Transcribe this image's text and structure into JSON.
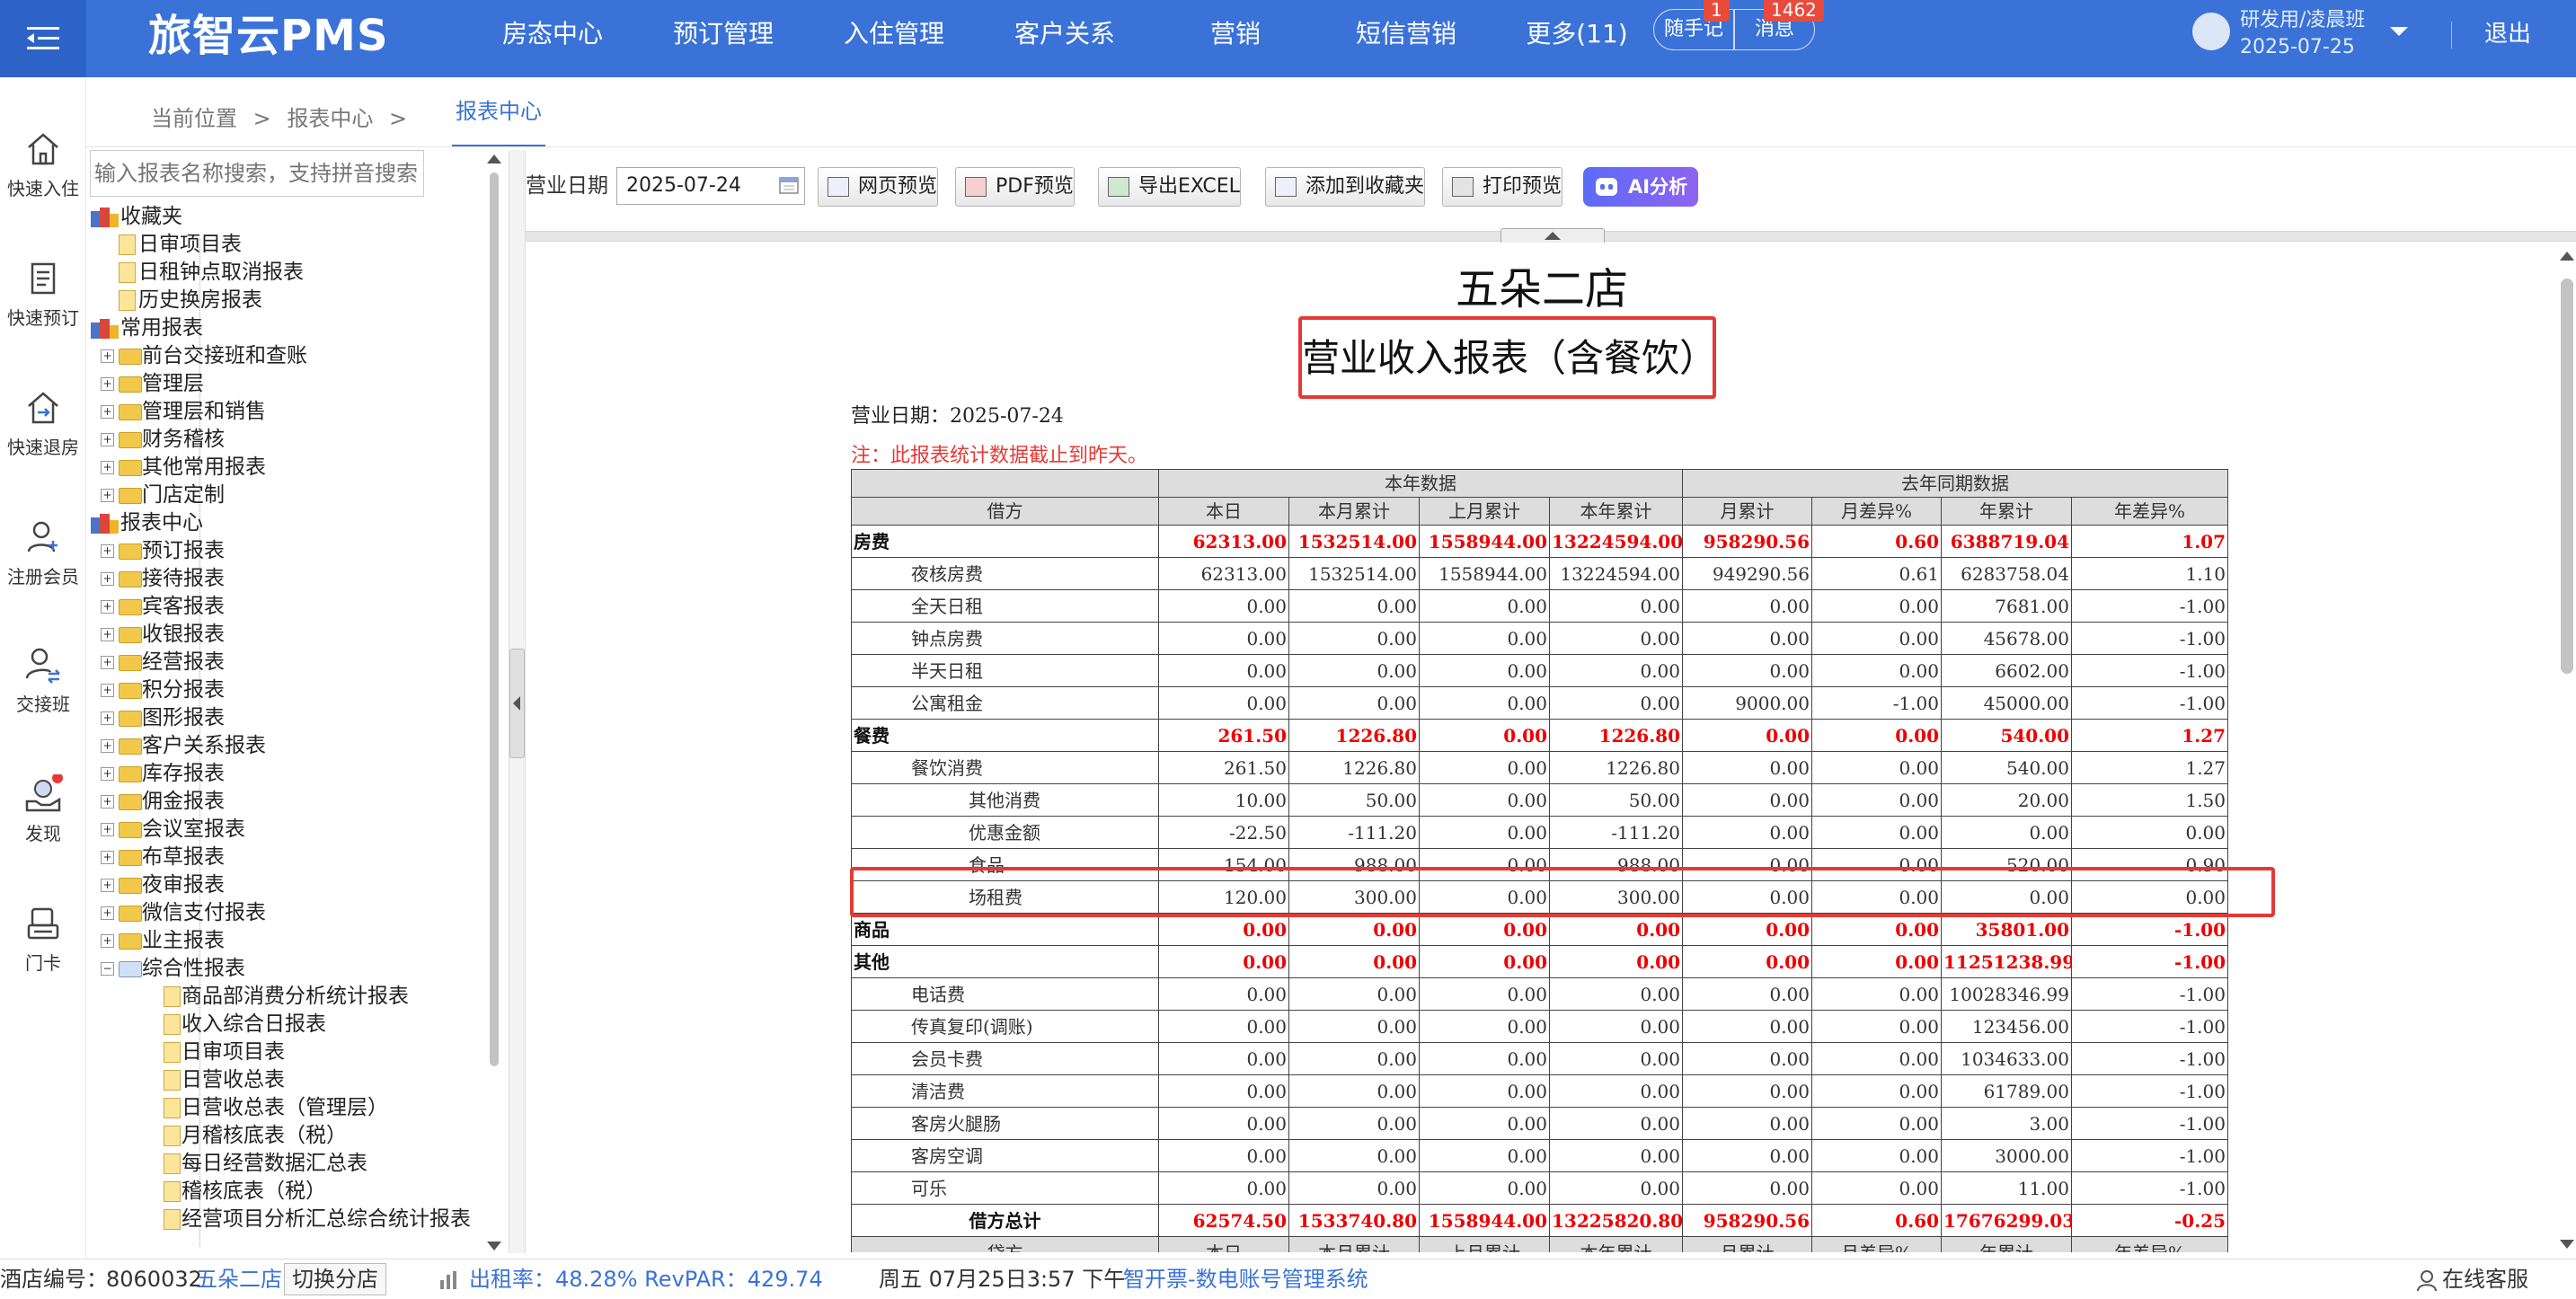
{
  "app": {
    "logo": "旅智云PMS"
  },
  "nav": [
    "房态中心",
    "预订管理",
    "入住管理",
    "客户关系",
    "营销",
    "短信营销",
    "更多(11)"
  ],
  "header": {
    "notes_label": "随手记",
    "notes_badge": "1",
    "msg_label": "消息",
    "msg_badge": "1462",
    "user_name": "研发用/凌晨班",
    "user_date": "2025-07-25",
    "logout": "退出"
  },
  "sidebar": [
    {
      "label": "快速入住",
      "icon": "home-icon"
    },
    {
      "label": "快速预订",
      "icon": "booking-icon"
    },
    {
      "label": "快速退房",
      "icon": "checkout-icon"
    },
    {
      "label": "注册会员",
      "icon": "add-member-icon"
    },
    {
      "label": "交接班",
      "icon": "shift-icon"
    },
    {
      "label": "发现",
      "icon": "discover-icon"
    },
    {
      "label": "门卡",
      "icon": "card-icon"
    }
  ],
  "breadcrumb": {
    "current": "当前位置",
    "sep1": ">",
    "item": "报表中心",
    "sep2": ">"
  },
  "tab": "报表中心",
  "tree": {
    "search_placeholder": "输入报表名称搜索，支持拼音搜索",
    "nodes": [
      {
        "level": 0,
        "type": "cat",
        "label": "收藏夹"
      },
      {
        "level": 1,
        "type": "doc",
        "label": "日审项目表"
      },
      {
        "level": 1,
        "type": "doc",
        "label": "日租钟点取消报表"
      },
      {
        "level": 1,
        "type": "doc",
        "label": "历史换房报表"
      },
      {
        "level": 0,
        "type": "cat",
        "label": "常用报表"
      },
      {
        "level": 1,
        "type": "folder",
        "label": "前台交接班和查账"
      },
      {
        "level": 1,
        "type": "folder",
        "label": "管理层"
      },
      {
        "level": 1,
        "type": "folder",
        "label": "管理层和销售"
      },
      {
        "level": 1,
        "type": "folder",
        "label": "财务稽核"
      },
      {
        "level": 1,
        "type": "folder",
        "label": "其他常用报表"
      },
      {
        "level": 1,
        "type": "folder",
        "label": "门店定制"
      },
      {
        "level": 0,
        "type": "cat",
        "label": "报表中心"
      },
      {
        "level": 1,
        "type": "folder",
        "label": "预订报表"
      },
      {
        "level": 1,
        "type": "folder",
        "label": "接待报表"
      },
      {
        "level": 1,
        "type": "folder",
        "label": "宾客报表"
      },
      {
        "level": 1,
        "type": "folder",
        "label": "收银报表"
      },
      {
        "level": 1,
        "type": "folder",
        "label": "经营报表"
      },
      {
        "level": 1,
        "type": "folder",
        "label": "积分报表"
      },
      {
        "level": 1,
        "type": "folder",
        "label": "图形报表"
      },
      {
        "level": 1,
        "type": "folder",
        "label": "客户关系报表"
      },
      {
        "level": 1,
        "type": "folder",
        "label": "库存报表"
      },
      {
        "level": 1,
        "type": "folder",
        "label": "佣金报表"
      },
      {
        "level": 1,
        "type": "folder",
        "label": "会议室报表"
      },
      {
        "level": 1,
        "type": "folder",
        "label": "布草报表"
      },
      {
        "level": 1,
        "type": "folder",
        "label": "夜审报表"
      },
      {
        "level": 1,
        "type": "folder",
        "label": "微信支付报表"
      },
      {
        "level": 1,
        "type": "folder",
        "label": "业主报表"
      },
      {
        "level": 1,
        "type": "openfolder",
        "label": "综合性报表"
      },
      {
        "level": 2,
        "type": "doc",
        "label": "商品部消费分析统计报表"
      },
      {
        "level": 2,
        "type": "doc",
        "label": "收入综合日报表"
      },
      {
        "level": 2,
        "type": "doc",
        "label": "日审项目表"
      },
      {
        "level": 2,
        "type": "doc",
        "label": "日营收总表"
      },
      {
        "level": 2,
        "type": "doc",
        "label": "日营收总表（管理层）"
      },
      {
        "level": 2,
        "type": "doc",
        "label": "月稽核底表（税）"
      },
      {
        "level": 2,
        "type": "doc",
        "label": "每日经营数据汇总表"
      },
      {
        "level": 2,
        "type": "doc",
        "label": "稽核底表（税）"
      },
      {
        "level": 2,
        "type": "doc",
        "label": "经营项目分析汇总综合统计报表"
      }
    ]
  },
  "toolbar": {
    "date_label": "营业日期",
    "date_value": "2025-07-24",
    "btn_web": "网页预览",
    "btn_pdf": "PDF预览",
    "btn_excel": "导出EXCEL",
    "btn_fav": "添加到收藏夹",
    "btn_print": "打印预览",
    "btn_ai": "AI分析"
  },
  "report": {
    "hotel": "五朵二店",
    "title": "营业收入报表（含餐饮）",
    "date_line": "营业日期：2025-07-24",
    "note": "注：此报表统计数据截止到昨天。",
    "group_this": "本年数据",
    "group_last": "去年同期数据",
    "columns": [
      "借方",
      "本日",
      "本月累计",
      "上月累计",
      "本年累计",
      "月累计",
      "月差异%",
      "年累计",
      "年差异%"
    ],
    "rows": [
      {
        "kind": "cat",
        "label": "房费",
        "values": [
          "62313.00",
          "1532514.00",
          "1558944.00",
          "13224594.00",
          "958290.56",
          "0.60",
          "6388719.04",
          "1.07"
        ]
      },
      {
        "kind": "l1",
        "label": "夜核房费",
        "values": [
          "62313.00",
          "1532514.00",
          "1558944.00",
          "13224594.00",
          "949290.56",
          "0.61",
          "6283758.04",
          "1.10"
        ]
      },
      {
        "kind": "l1",
        "label": "全天日租",
        "values": [
          "0.00",
          "0.00",
          "0.00",
          "0.00",
          "0.00",
          "0.00",
          "7681.00",
          "-1.00"
        ]
      },
      {
        "kind": "l1",
        "label": "钟点房费",
        "values": [
          "0.00",
          "0.00",
          "0.00",
          "0.00",
          "0.00",
          "0.00",
          "45678.00",
          "-1.00"
        ]
      },
      {
        "kind": "l1",
        "label": "半天日租",
        "values": [
          "0.00",
          "0.00",
          "0.00",
          "0.00",
          "0.00",
          "0.00",
          "6602.00",
          "-1.00"
        ]
      },
      {
        "kind": "l1",
        "label": "公寓租金",
        "values": [
          "0.00",
          "0.00",
          "0.00",
          "0.00",
          "9000.00",
          "-1.00",
          "45000.00",
          "-1.00"
        ]
      },
      {
        "kind": "cat",
        "label": "餐费",
        "values": [
          "261.50",
          "1226.80",
          "0.00",
          "1226.80",
          "0.00",
          "0.00",
          "540.00",
          "1.27"
        ]
      },
      {
        "kind": "l1",
        "label": "餐饮消费",
        "values": [
          "261.50",
          "1226.80",
          "0.00",
          "1226.80",
          "0.00",
          "0.00",
          "540.00",
          "1.27"
        ]
      },
      {
        "kind": "l2",
        "label": "其他消费",
        "values": [
          "10.00",
          "50.00",
          "0.00",
          "50.00",
          "0.00",
          "0.00",
          "20.00",
          "1.50"
        ]
      },
      {
        "kind": "l2",
        "label": "优惠金额",
        "values": [
          "-22.50",
          "-111.20",
          "0.00",
          "-111.20",
          "0.00",
          "0.00",
          "0.00",
          "0.00"
        ]
      },
      {
        "kind": "l2",
        "label": "食品",
        "values": [
          "154.00",
          "988.00",
          "0.00",
          "988.00",
          "0.00",
          "0.00",
          "520.00",
          "0.90"
        ]
      },
      {
        "kind": "l2",
        "label": "场租费",
        "values": [
          "120.00",
          "300.00",
          "0.00",
          "300.00",
          "0.00",
          "0.00",
          "0.00",
          "0.00"
        ]
      },
      {
        "kind": "cat",
        "label": "商品",
        "values": [
          "0.00",
          "0.00",
          "0.00",
          "0.00",
          "0.00",
          "0.00",
          "35801.00",
          "-1.00"
        ]
      },
      {
        "kind": "cat",
        "label": "其他",
        "values": [
          "0.00",
          "0.00",
          "0.00",
          "0.00",
          "0.00",
          "0.00",
          "11251238.99",
          "-1.00"
        ]
      },
      {
        "kind": "l1",
        "label": "电话费",
        "values": [
          "0.00",
          "0.00",
          "0.00",
          "0.00",
          "0.00",
          "0.00",
          "10028346.99",
          "-1.00"
        ]
      },
      {
        "kind": "l1",
        "label": "传真复印(调账)",
        "values": [
          "0.00",
          "0.00",
          "0.00",
          "0.00",
          "0.00",
          "0.00",
          "123456.00",
          "-1.00"
        ]
      },
      {
        "kind": "l1",
        "label": "会员卡费",
        "values": [
          "0.00",
          "0.00",
          "0.00",
          "0.00",
          "0.00",
          "0.00",
          "1034633.00",
          "-1.00"
        ]
      },
      {
        "kind": "l1",
        "label": "清洁费",
        "values": [
          "0.00",
          "0.00",
          "0.00",
          "0.00",
          "0.00",
          "0.00",
          "61789.00",
          "-1.00"
        ]
      },
      {
        "kind": "l1",
        "label": "客房火腿肠",
        "values": [
          "0.00",
          "0.00",
          "0.00",
          "0.00",
          "0.00",
          "0.00",
          "3.00",
          "-1.00"
        ]
      },
      {
        "kind": "l1",
        "label": "客房空调",
        "values": [
          "0.00",
          "0.00",
          "0.00",
          "0.00",
          "0.00",
          "0.00",
          "3000.00",
          "-1.00"
        ]
      },
      {
        "kind": "l1",
        "label": "可乐",
        "values": [
          "0.00",
          "0.00",
          "0.00",
          "0.00",
          "0.00",
          "0.00",
          "11.00",
          "-1.00"
        ]
      },
      {
        "kind": "total",
        "label": "借方总计",
        "values": [
          "62574.50",
          "1533740.80",
          "1558944.00",
          "13225820.80",
          "958290.56",
          "0.60",
          "17676299.03",
          "-0.25"
        ]
      },
      {
        "kind": "head2",
        "label": "贷方",
        "values": [
          "本日",
          "本月累计",
          "上月累计",
          "本年累计",
          "月累计",
          "月差异%",
          "年累计",
          "年差异%"
        ]
      }
    ]
  },
  "status": {
    "hotel_code_label": "酒店编号：",
    "hotel_code": "8060032",
    "hotel_name": "五朵二店",
    "switch": "切换分店",
    "occupancy": "出租率：48.28% RevPAR：429.74",
    "datetime": "周五 07月25日3:57 下午",
    "promo": "智开票-数电账号管理系统",
    "service": "在线客服"
  },
  "colors": {
    "brand": "#3a72d8",
    "highlight": "#e53935",
    "value_red": "#ee0000"
  }
}
